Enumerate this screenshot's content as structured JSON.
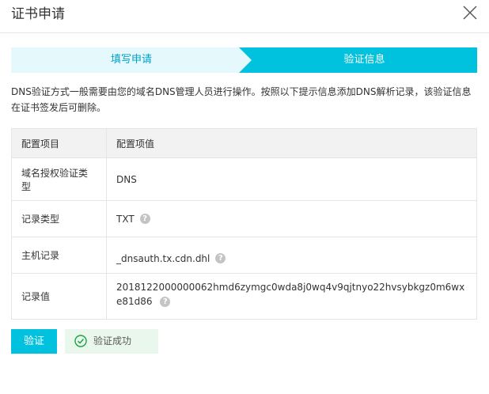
{
  "dialog": {
    "title": "证书申请"
  },
  "steps": [
    {
      "label": "填写申请",
      "state": "done"
    },
    {
      "label": "验证信息",
      "state": "active"
    }
  ],
  "description": "DNS验证方式一般需要由您的域名DNS管理人员进行操作。按照以下提示信息添加DNS解析记录，该验证信息在证书签发后可删除。",
  "table": {
    "headers": [
      "配置项目",
      "配置项值"
    ],
    "rows": [
      {
        "label": "域名授权验证类型",
        "value": "DNS",
        "help": false
      },
      {
        "label": "记录类型",
        "value": "TXT",
        "help": true
      },
      {
        "label": "主机记录",
        "value": "_dnsauth.tx.cdn.dhl",
        "help": true
      },
      {
        "label": "记录值",
        "value": "2018122000000062hmd6zymgc0wda8j0wq4v9qjtnyo22hvsybkgz0m6wxe81d86",
        "help": true
      }
    ]
  },
  "actions": {
    "verify_label": "验证",
    "status_label": "验证成功"
  },
  "colors": {
    "accent": "#00c1de",
    "step_done_bg": "#e5f8fb",
    "step_done_text": "#00a2ca",
    "success_bg": "#eaf7ec",
    "success_icon": "#1aa340"
  },
  "icons": {
    "close": "close-icon",
    "help": "help-icon",
    "success": "check-circle-icon"
  }
}
